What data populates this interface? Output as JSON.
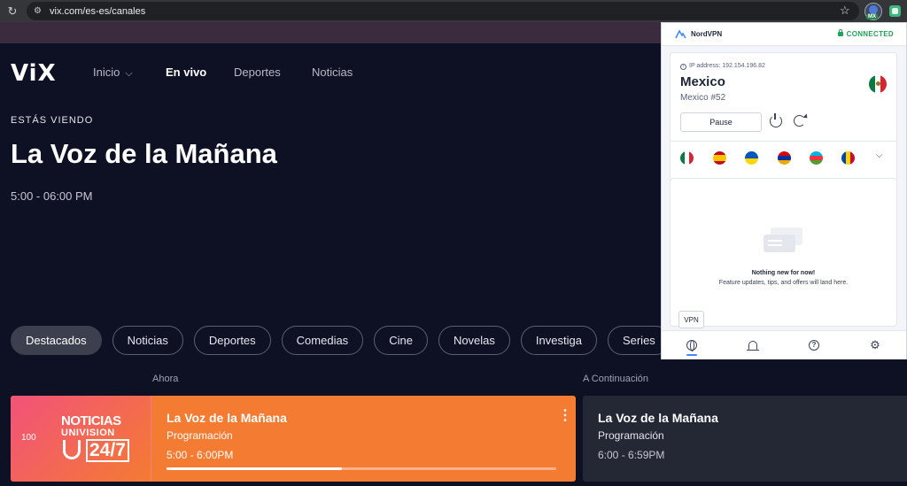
{
  "browser": {
    "url": "vix.com/es-es/canales",
    "extension_badge": "MX"
  },
  "vix": {
    "logo": "ViX",
    "nav": [
      {
        "label": "Inicio"
      },
      {
        "label": "En vivo"
      },
      {
        "label": "Deportes"
      },
      {
        "label": "Noticias"
      }
    ],
    "hero": {
      "eyebrow": "ESTÁS VIENDO",
      "title": "La Voz de la Mañana",
      "time": "5:00  -  06:00 PM"
    },
    "categories": [
      "Destacados",
      "Noticias",
      "Deportes",
      "Comedias",
      "Cine",
      "Novelas",
      "Investiga",
      "Series"
    ],
    "schedule": {
      "now_label": "Ahora",
      "next_label": "A Continuación",
      "channel_number": "100",
      "channel_logo": {
        "line1": "NOTICIAS",
        "line2": "UNIVISION",
        "line3": "24/7"
      },
      "now": {
        "title": "La Voz de la Mañana",
        "subtitle": "Programación",
        "time": "5:00  -  6:00PM",
        "progress": 0.45
      },
      "next": {
        "title": "La Voz de la Mañana",
        "subtitle": "Programación",
        "time": "6:00  -  6:59PM"
      }
    }
  },
  "vpn": {
    "brand": "NordVPN",
    "status": "CONNECTED",
    "ip_label": "IP address: 192.154.196.82",
    "country": "Mexico",
    "server": "Mexico #52",
    "pause_label": "Pause",
    "quick_flags": [
      "mexico-flag",
      "spain-flag",
      "ukraine-flag",
      "armenia-flag",
      "azerbaijan-flag",
      "moldova-flag"
    ],
    "news_title": "Nothing new for now!",
    "news_subtitle": "Feature updates, tips, and offers will land here.",
    "vpn_chip": "VPN",
    "tabs": [
      "globe-icon",
      "bell-icon",
      "help-icon",
      "gear-icon"
    ]
  },
  "colors": {
    "page_bg": "#0e1124",
    "now_card": "#f47b32",
    "next_card": "#242734",
    "vpn_connected": "#24a15a"
  }
}
